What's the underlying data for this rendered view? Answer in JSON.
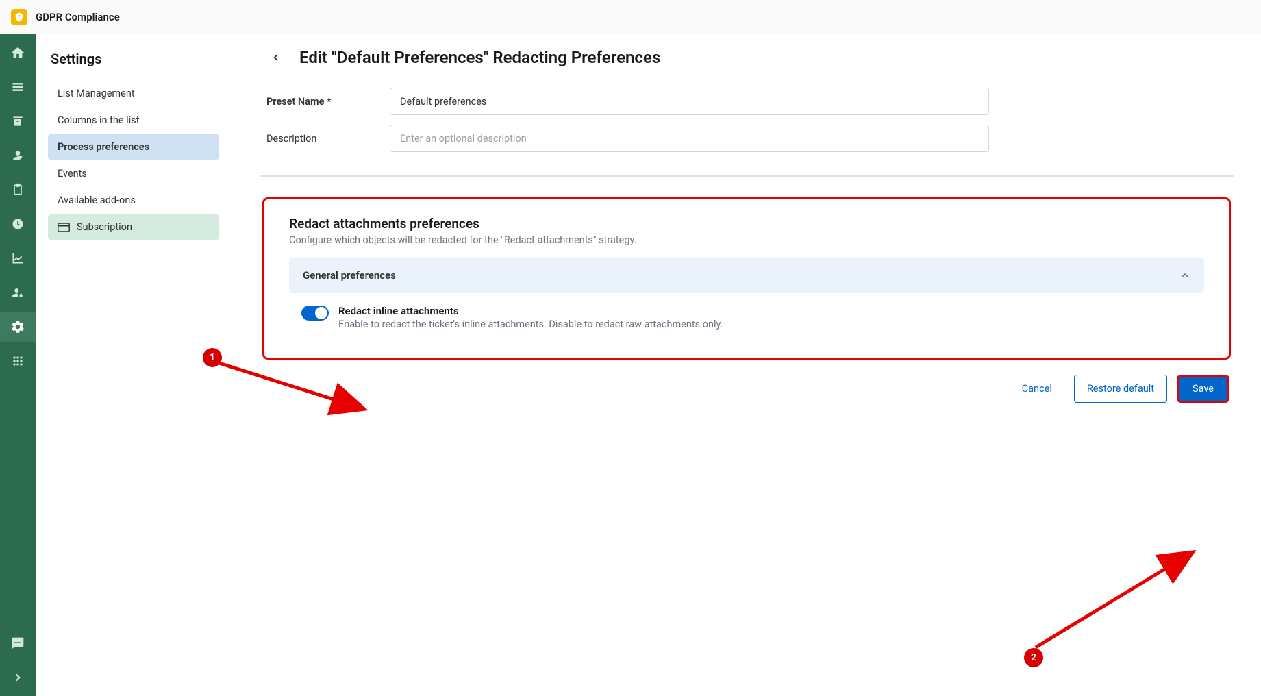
{
  "app": {
    "title": "GDPR Compliance"
  },
  "settings_nav": {
    "title": "Settings",
    "items": [
      {
        "label": "List Management"
      },
      {
        "label": "Columns in the list"
      },
      {
        "label": "Process preferences"
      },
      {
        "label": "Events"
      },
      {
        "label": "Available add-ons"
      },
      {
        "label": "Subscription"
      }
    ]
  },
  "page": {
    "title": "Edit \"Default Preferences\" Redacting Preferences",
    "preset_name_label": "Preset Name *",
    "preset_name_value": "Default preferences",
    "description_label": "Description",
    "description_placeholder": "Enter an optional description"
  },
  "redact_section": {
    "title": "Redact attachments preferences",
    "desc": "Configure which objects will be redacted for the \"Redact attachments\" strategy.",
    "accordion_title": "General preferences",
    "toggle_label": "Redact inline attachments",
    "toggle_desc": "Enable to redact the ticket's inline attachments. Disable to redact raw attachments only."
  },
  "buttons": {
    "cancel": "Cancel",
    "restore": "Restore default",
    "save": "Save"
  },
  "annotations": {
    "badge1": "1",
    "badge2": "2"
  }
}
